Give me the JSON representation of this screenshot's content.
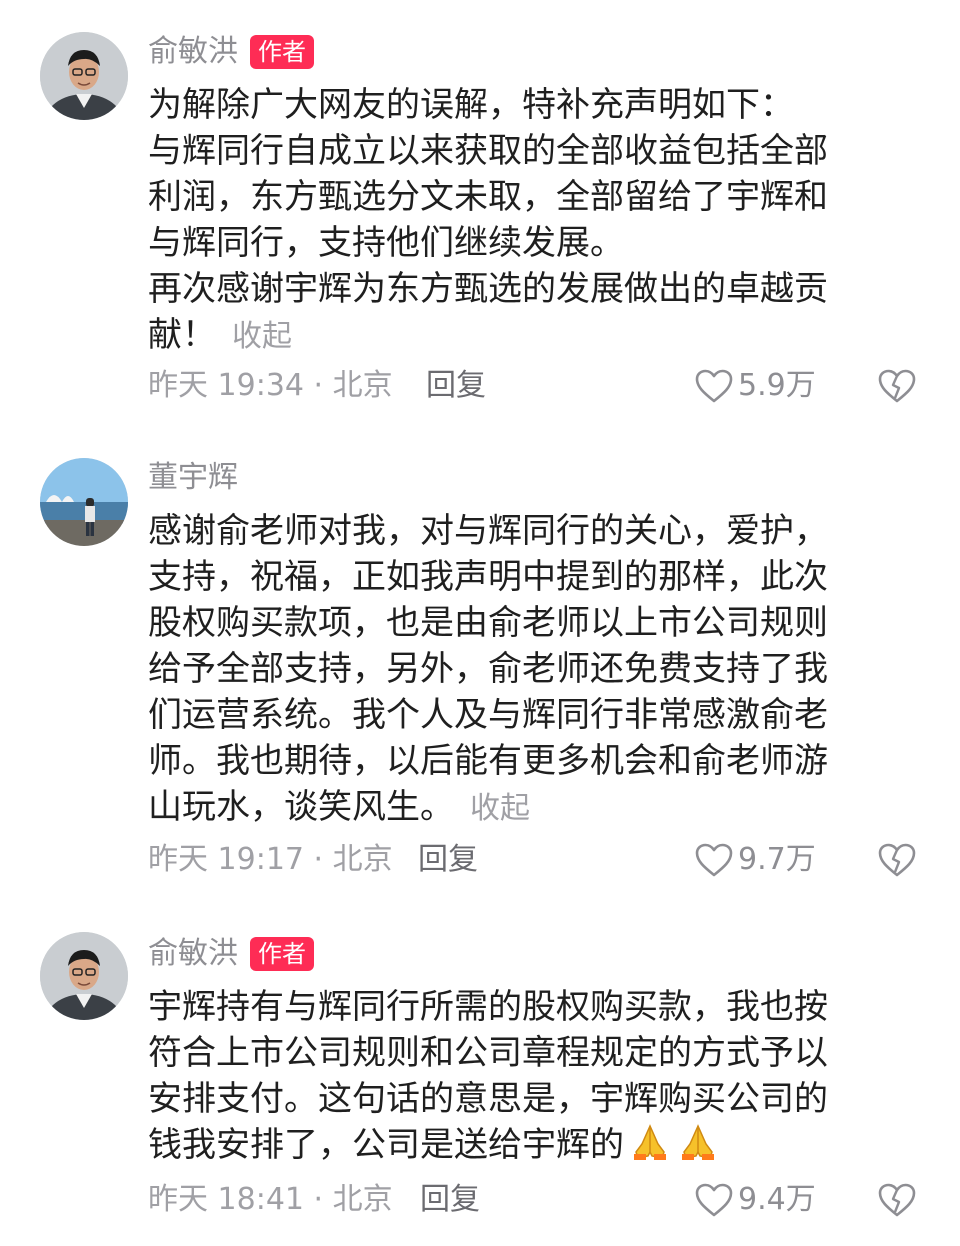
{
  "comments": [
    {
      "author": "俞敏洪",
      "badge": "作者",
      "lines": [
        "为解除广大网友的误解，特补充声明如下：",
        "与辉同行自成立以来获取的全部收益包括全部",
        "利润，东方甄选分文未取，全部留给了宇辉和",
        "与辉同行，支持他们继续发展。",
        "再次感谢宇辉为东方甄选的发展做出的卓越贡",
        "献！"
      ],
      "collapse": "收起",
      "time": "昨天 19:34 · 北京",
      "reply": "回复",
      "likes": "5.9万"
    },
    {
      "author": "董宇辉",
      "badge": "",
      "lines": [
        "感谢俞老师对我，对与辉同行的关心，爱护，",
        "支持，祝福，正如我声明中提到的那样，此次",
        "股权购买款项，也是由俞老师以上市公司规则",
        "给予全部支持，另外，俞老师还免费支持了我",
        "们运营系统。我个人及与辉同行非常感激俞老",
        "师。我也期待，以后能有更多机会和俞老师游",
        "山玩水，谈笑风生。"
      ],
      "collapse": "收起",
      "time": "昨天 19:17 · 北京",
      "reply": "回复",
      "likes": "9.7万"
    },
    {
      "author": "俞敏洪",
      "badge": "作者",
      "lines": [
        "宇辉持有与辉同行所需的股权购买款，我也按",
        "符合上市公司规则和公司章程规定的方式予以",
        "安排支付。这句话的意思是，宇辉购买公司的",
        "钱我安排了，公司是送给宇辉的"
      ],
      "emoji": [
        "folded-hands-icon",
        "folded-hands-icon"
      ],
      "time": "昨天 18:41 · 北京",
      "reply": "回复",
      "likes": "9.4万"
    }
  ],
  "colors": {
    "badge": "#fe2c55",
    "name": "#8e8e93",
    "text": "#1f1f1f",
    "meta": "#a0a0a5"
  }
}
